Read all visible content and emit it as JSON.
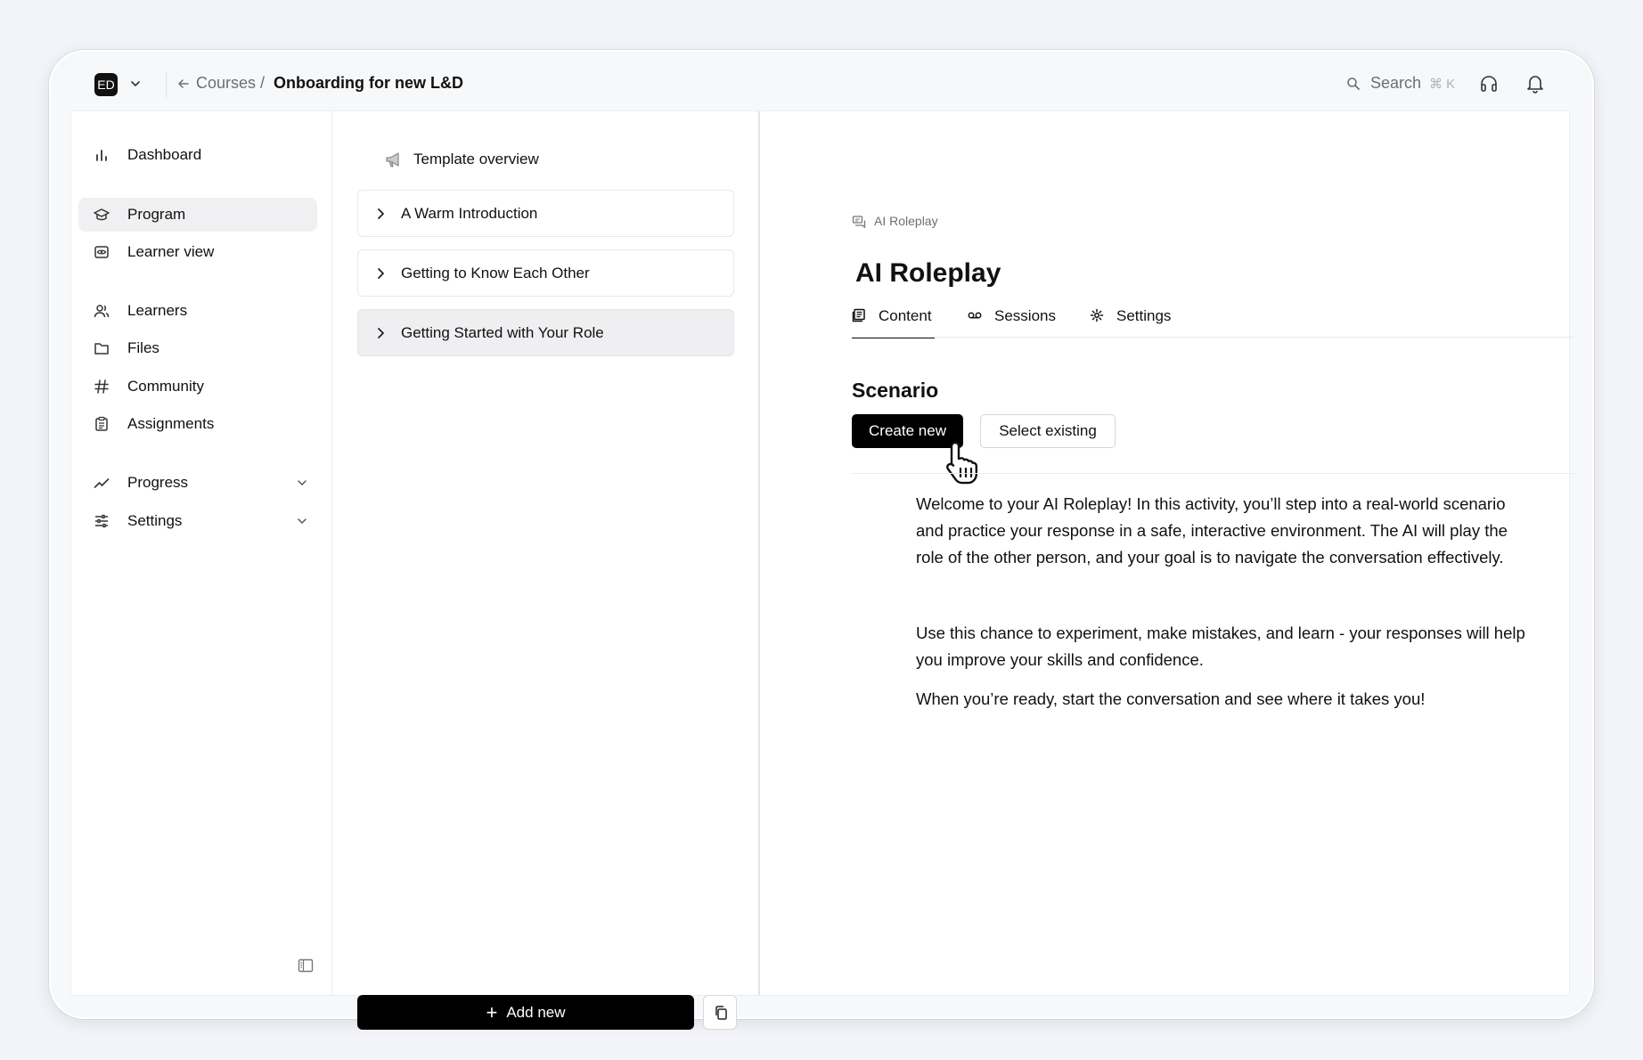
{
  "workspace": {
    "badge": "ED"
  },
  "breadcrumb": {
    "parent": "Courses",
    "separator": "/",
    "current": "Onboarding for new L&D"
  },
  "search": {
    "label": "Search",
    "shortcut": "⌘ K"
  },
  "sidebar": {
    "items": [
      {
        "label": "Dashboard",
        "icon": "bar-chart-icon"
      },
      {
        "label": "Program",
        "icon": "graduation-cap-icon",
        "active": true
      },
      {
        "label": "Learner view",
        "icon": "eye-icon"
      },
      {
        "label": "Learners",
        "icon": "users-icon"
      },
      {
        "label": "Files",
        "icon": "folder-icon"
      },
      {
        "label": "Community",
        "icon": "hash-icon"
      },
      {
        "label": "Assignments",
        "icon": "clipboard-icon"
      },
      {
        "label": "Progress",
        "icon": "trend-icon"
      },
      {
        "label": "Settings",
        "icon": "sliders-icon"
      }
    ]
  },
  "outline": {
    "overview_label": "Template overview",
    "modules": [
      {
        "label": "A Warm Introduction"
      },
      {
        "label": "Getting to Know Each Other"
      },
      {
        "label": "Getting Started with Your Role",
        "active": true
      }
    ],
    "add_label": "Add new"
  },
  "activity": {
    "crumb": "AI Roleplay",
    "title": "AI Roleplay",
    "tabs": [
      {
        "label": "Content",
        "active": true
      },
      {
        "label": "Sessions"
      },
      {
        "label": "Settings"
      }
    ],
    "section_title": "Scenario",
    "create_label": "Create new",
    "select_label": "Select existing",
    "paragraphs": [
      "Welcome to your AI Roleplay! In this activity, you’ll step into a real-world scenario and practice your response in a safe, interactive environment. The AI will play the role of the other person, and your goal is to navigate the conversation effectively.",
      "Use this chance to experiment, make mistakes, and learn - your responses will help you improve your skills and confidence.",
      "When you’re ready, start the conversation and see where it takes you!"
    ]
  },
  "colors": {
    "accent": "#000000",
    "active_bg": "#f0f0f2",
    "muted_text": "#6b6f78"
  }
}
